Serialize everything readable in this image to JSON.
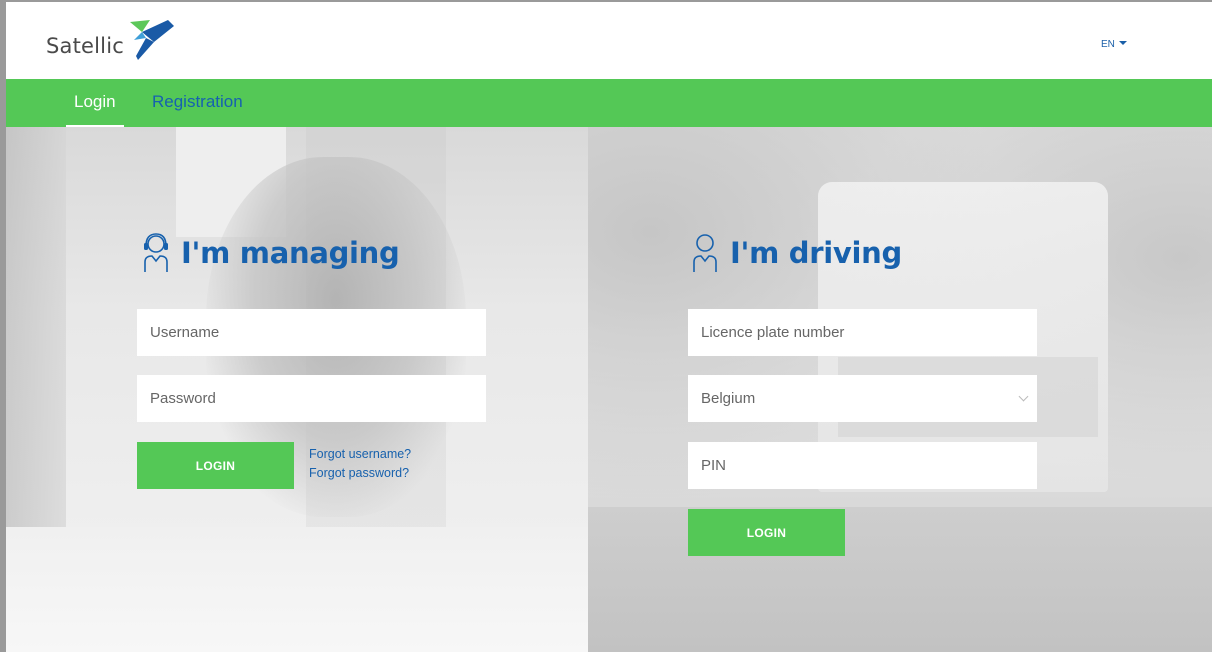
{
  "header": {
    "logo_text": "Satellic",
    "language": "EN"
  },
  "nav": {
    "tabs": [
      {
        "label": "Login",
        "active": true
      },
      {
        "label": "Registration",
        "active": false
      }
    ]
  },
  "managing": {
    "title": "I'm managing",
    "username_placeholder": "Username",
    "password_placeholder": "Password",
    "login_label": "LOGIN",
    "forgot_username": "Forgot username?",
    "forgot_password": "Forgot password?"
  },
  "driving": {
    "title": "I'm driving",
    "plate_placeholder": "Licence plate number",
    "country_value": "Belgium",
    "pin_placeholder": "PIN",
    "login_label": "LOGIN"
  },
  "colors": {
    "brand_green": "#54c856",
    "brand_blue": "#1761ad"
  },
  "icons": {
    "manager": "headset-user-icon",
    "driver": "user-icon",
    "language_caret": "caret-down-icon",
    "select_chevron": "chevron-down-icon"
  }
}
